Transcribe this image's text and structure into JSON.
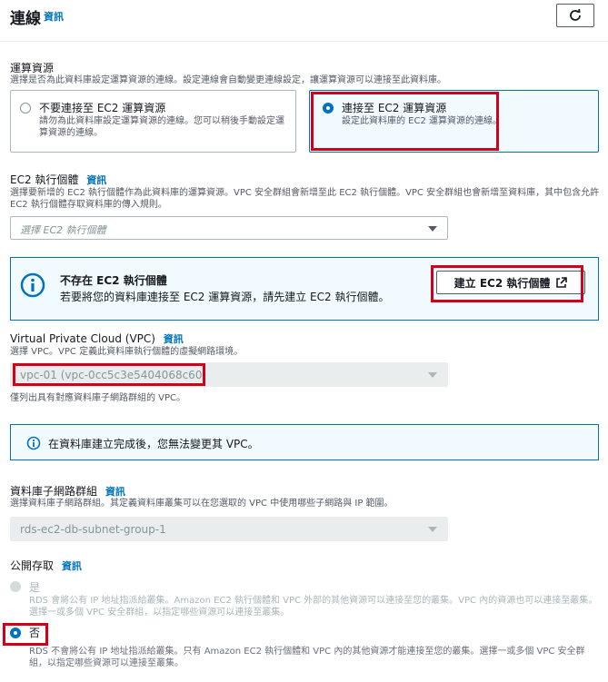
{
  "header": {
    "title": "連線",
    "info": "資訊"
  },
  "compute": {
    "label": "運算資源",
    "description": "選擇是否為此資料庫設定運算資源的連線。設定連線會自動變更連線設定，讓運算資源可以連接至此資料庫。",
    "options": [
      {
        "title": "不要連接至 EC2 運算資源",
        "desc": "請勿為此資料庫設定運算資源的連線。您可以稍後手動設定運算資源的連線。",
        "selected": false
      },
      {
        "title": "連接至 EC2 運算資源",
        "desc": "設定此資料庫的 EC2 運算資源的連線。",
        "selected": true
      }
    ]
  },
  "ec2": {
    "label": "EC2 執行個體",
    "info": "資訊",
    "description": "選擇要新增的 EC2 執行個體作為此資料庫的運算資源。VPC 安全群組會新增至此 EC2 執行個體。VPC 安全群組也會新增至資料庫，其中包含允許 EC2 執行個體存取資料庫的傳入規則。",
    "placeholder": "選擇 EC2 執行個體"
  },
  "alert_ec2": {
    "title": "不存在 EC2 執行個體",
    "desc": "若要將您的資料庫連接至 EC2 運算資源，請先建立 EC2 執行個體。",
    "button": "建立 EC2 執行個體"
  },
  "vpc": {
    "label": "Virtual Private Cloud (VPC)",
    "info": "資訊",
    "description": "選擇 VPC。VPC 定義此資料庫執行個體的虛擬網路環境。",
    "value": "vpc-01 (vpc-0cc5c3e5404068c60)",
    "hint": "僅列出具有對應資料庫子網路群組的 VPC。"
  },
  "alert_vpc": {
    "text": "在資料庫建立完成後，您無法變更其 VPC。"
  },
  "subnet": {
    "label": "資料庫子網路群組",
    "info": "資訊",
    "description": "選擇資料庫子網路群組。其定義資料庫叢集可以在您選取的 VPC 中使用哪些子網路與 IP 範圍。",
    "value": "rds-ec2-db-subnet-group-1"
  },
  "public": {
    "label": "公開存取",
    "info": "資訊",
    "yes": {
      "title": "是",
      "desc": "RDS 會將公有 IP 地址指派給叢集。Amazon EC2 執行個體和 VPC 外部的其他資源可以連接至您的叢集。VPC 內的資源也可以連接至叢集。選擇一或多個 VPC 安全群組，以指定哪些資源可以連接至叢集。"
    },
    "no": {
      "title": "否",
      "desc": "RDS 不會將公有 IP 地址指派給叢集。只有 Amazon EC2 執行個體和 VPC 內的其他資源才能連接至您的叢集。選擇一或多個 VPC 安全群組，以指定哪些資源可以連接至叢集。"
    }
  }
}
